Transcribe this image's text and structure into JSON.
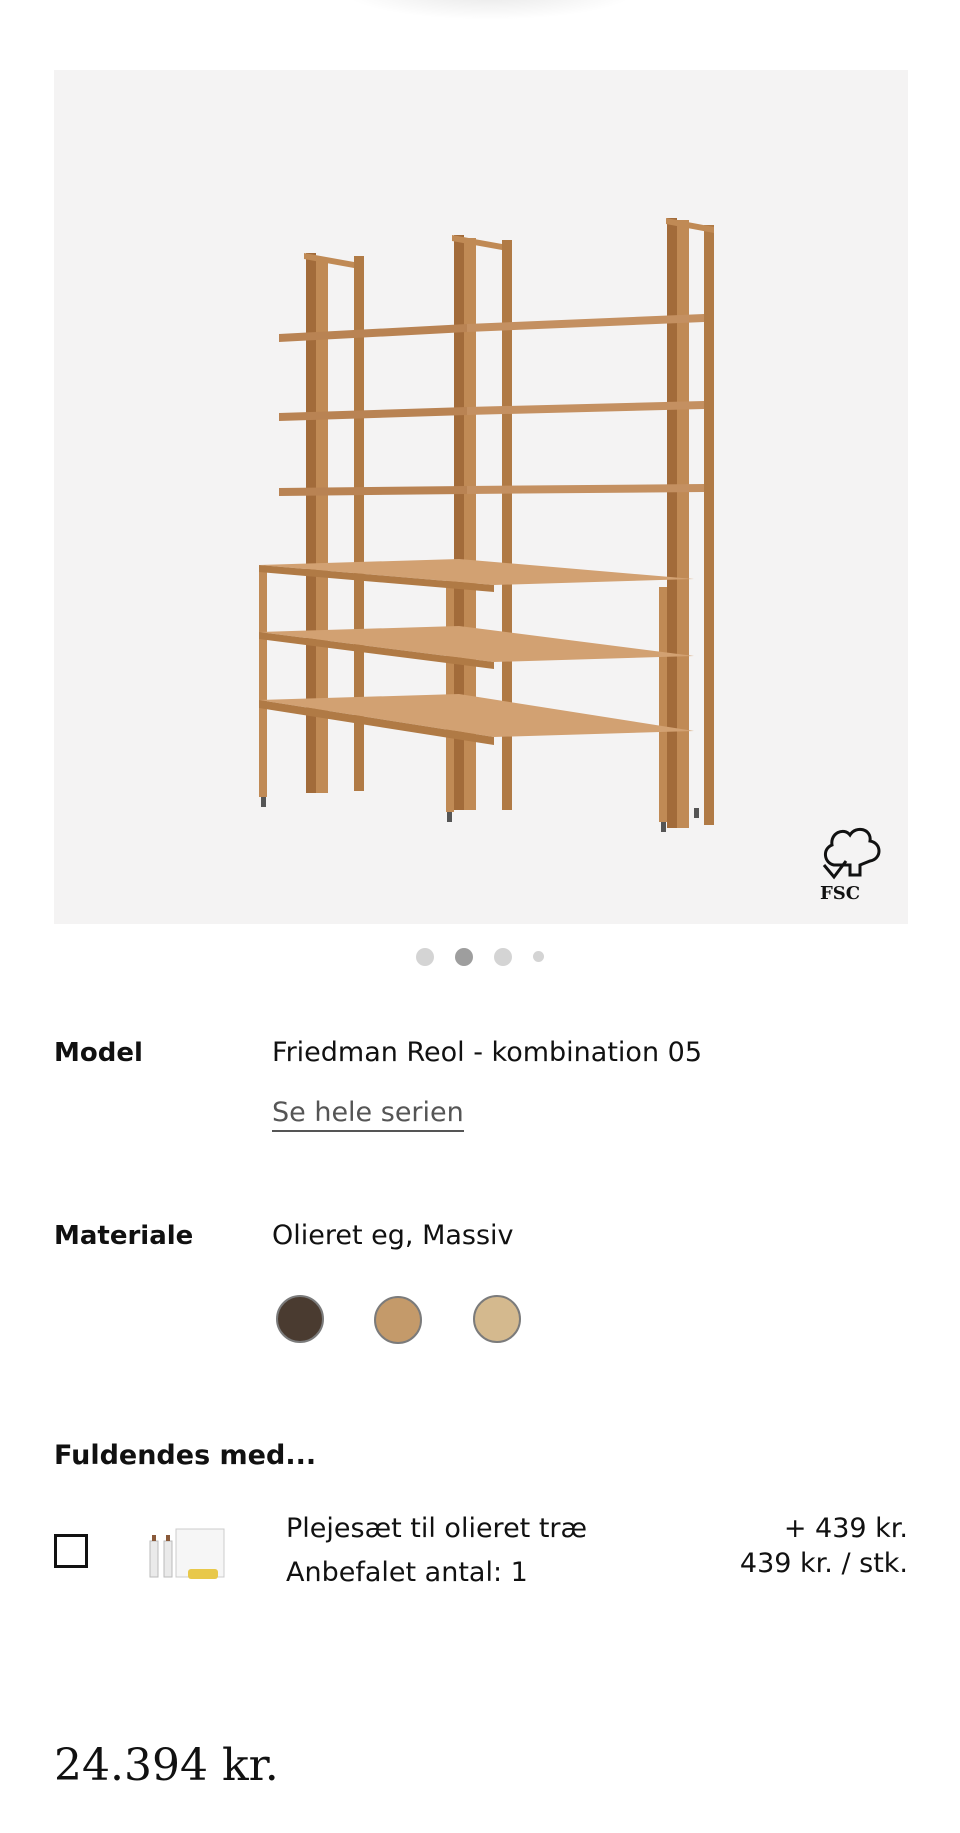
{
  "gallery": {
    "image_alt": "Friedman Reol - kombination 05",
    "badge": "FSC",
    "slide_count": 4,
    "active_slide": 2
  },
  "details": {
    "model_label": "Model",
    "model_value": "Friedman Reol - kombination 05",
    "series_link": "Se hele serien",
    "material_label": "Materiale",
    "material_value": "Olieret eg, Massiv",
    "swatches": [
      {
        "name": "dark-oak",
        "color": "#4a3b30"
      },
      {
        "name": "oiled-oak",
        "color": "#c49a6a",
        "selected": true
      },
      {
        "name": "light-oak",
        "color": "#d4b98e"
      }
    ]
  },
  "complete_with": {
    "title": "Fuldendes med...",
    "items": [
      {
        "name": "Plejesæt til olieret træ",
        "recommended": "Anbefalet antal: 1",
        "price": "+ 439 kr.",
        "unit_price": "439 kr. / stk.",
        "checked": false
      }
    ]
  },
  "price": {
    "total": "24.394 kr."
  },
  "colors": {
    "wood": "#c08a55",
    "wood_dark": "#a26b3a",
    "hero_bg": "#f4f3f3"
  }
}
